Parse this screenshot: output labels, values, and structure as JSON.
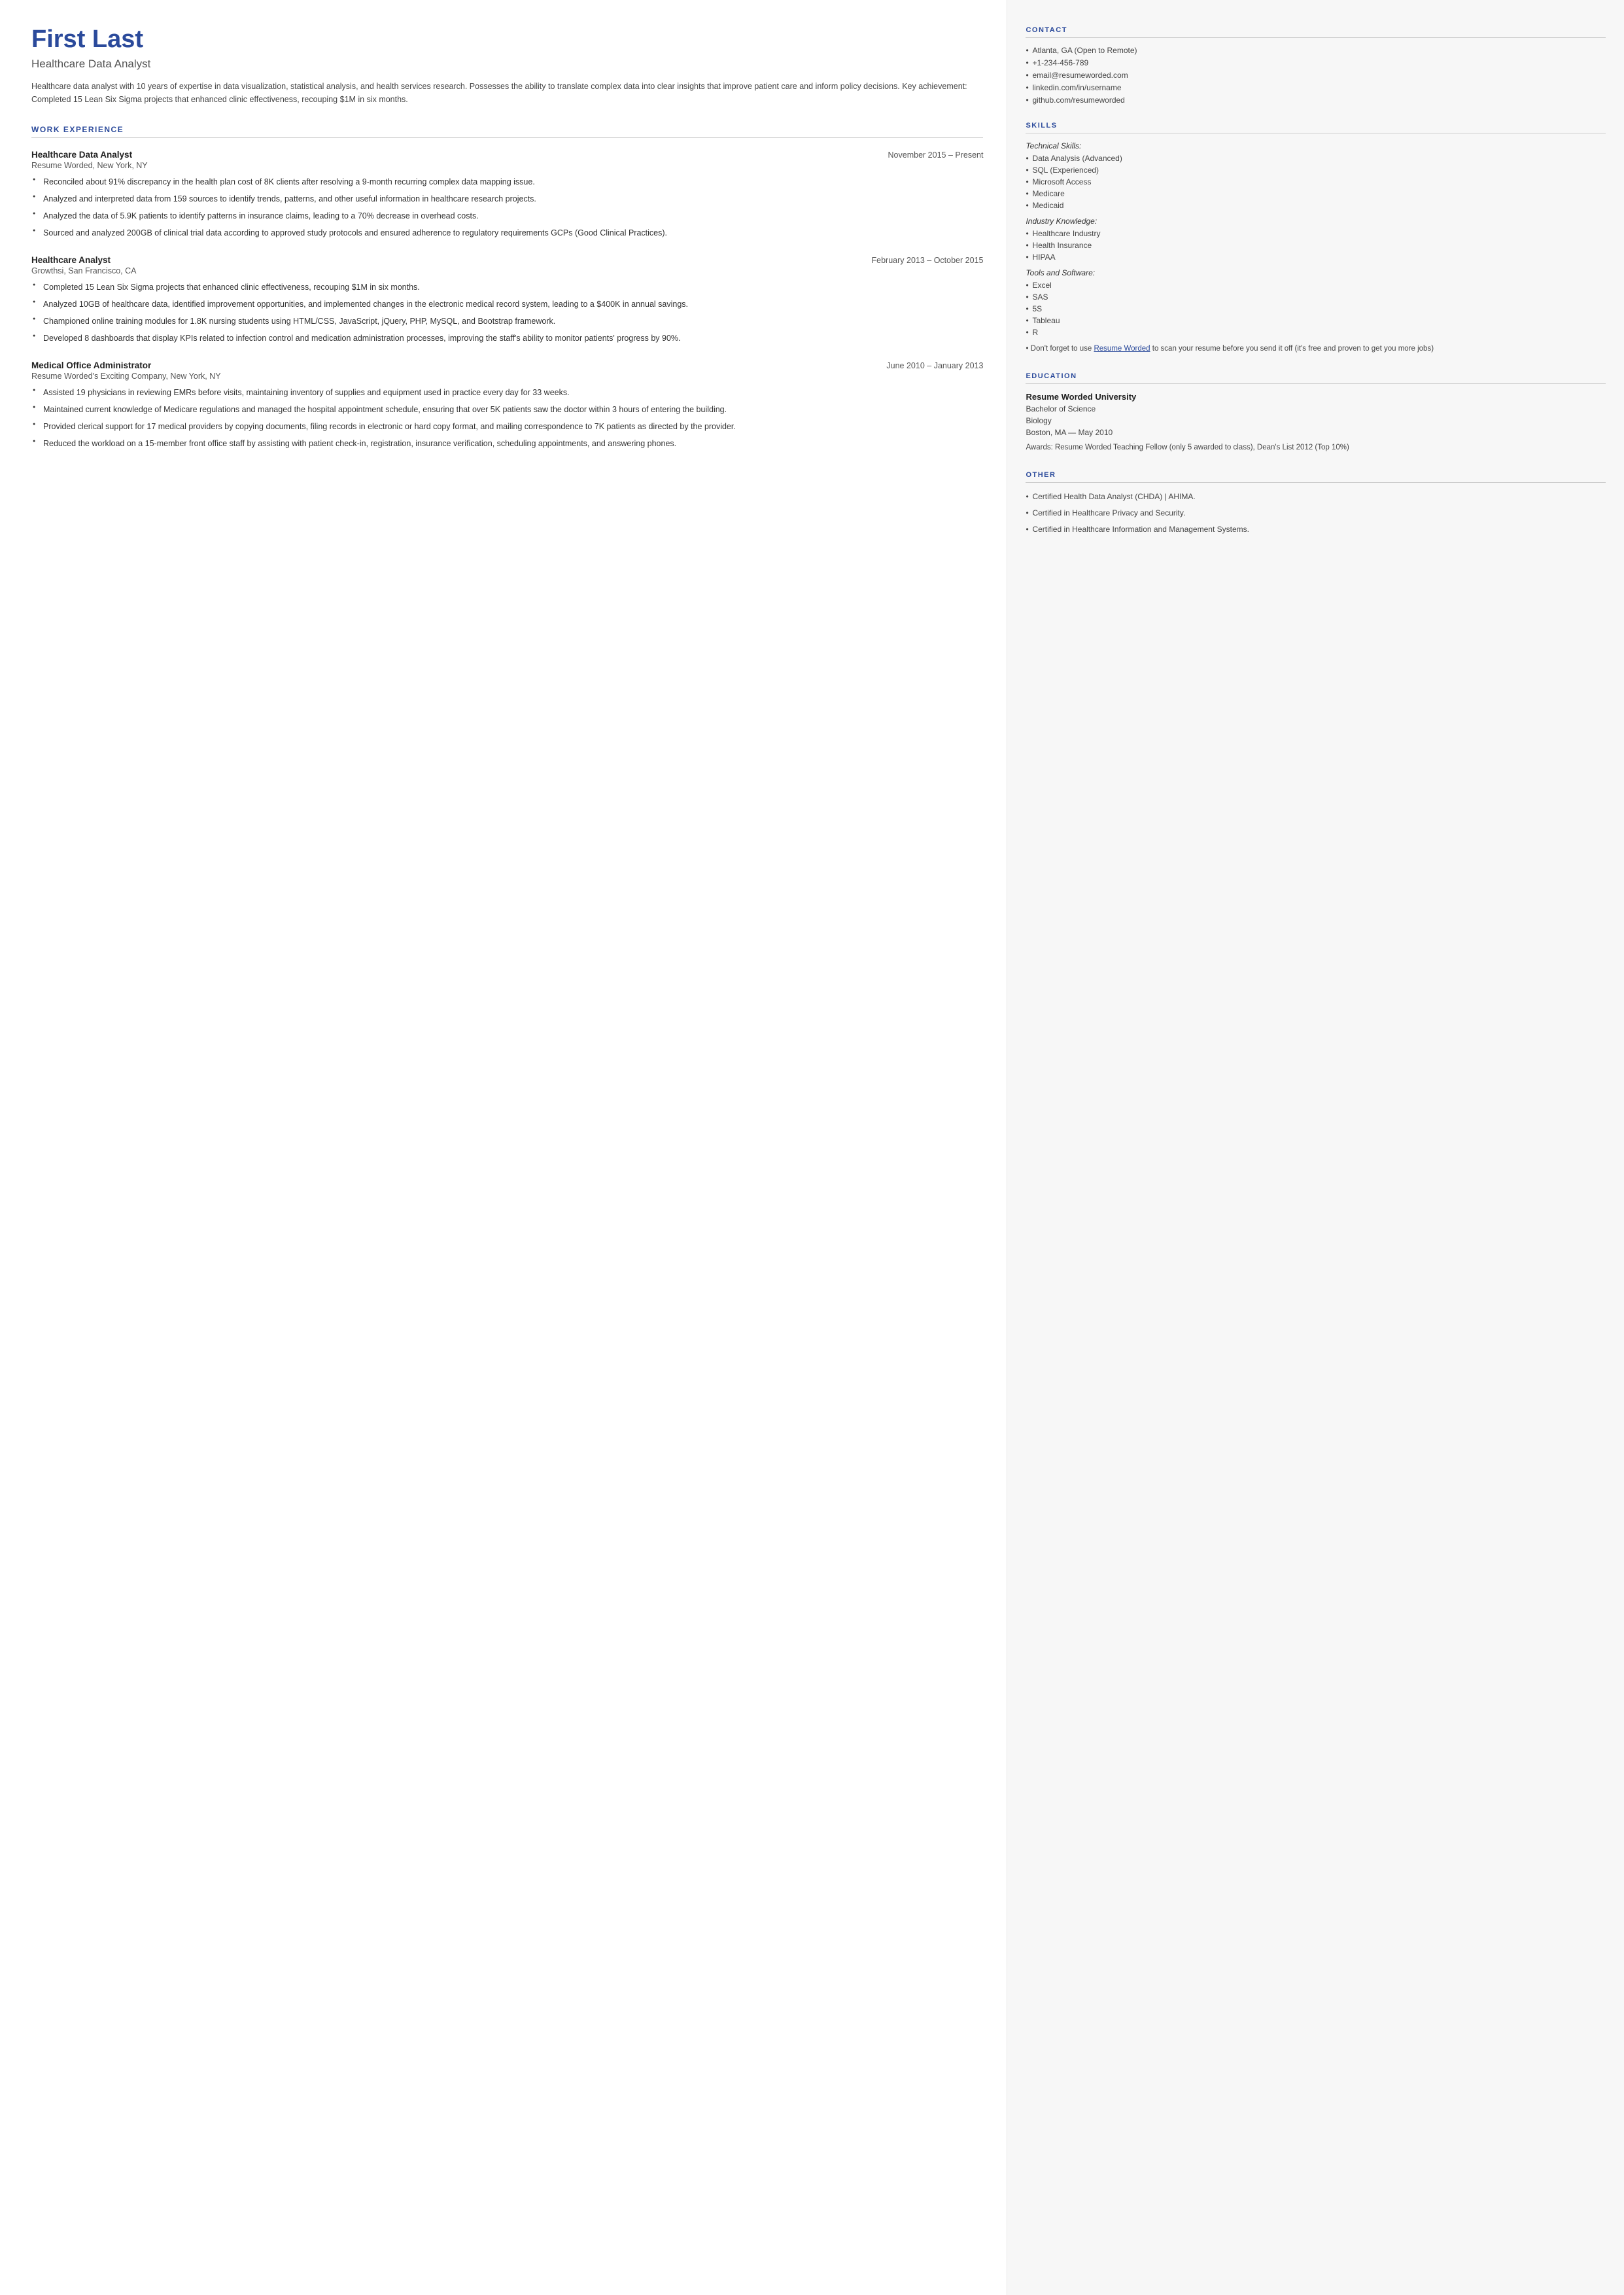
{
  "header": {
    "name": "First Last",
    "title": "Healthcare Data Analyst",
    "summary": "Healthcare data analyst with 10 years of expertise in data visualization, statistical analysis, and health services research. Possesses the ability to translate complex data into clear insights that improve patient care and inform policy decisions. Key achievement: Completed 15 Lean Six Sigma projects that enhanced clinic effectiveness, recouping $1M in six months."
  },
  "sections": {
    "work_experience_label": "WORK EXPERIENCE",
    "skills_label": "SKILLS",
    "contact_label": "CONTACT",
    "education_label": "EDUCATION",
    "other_label": "OTHER"
  },
  "jobs": [
    {
      "title": "Healthcare Data Analyst",
      "dates": "November 2015 – Present",
      "company": "Resume Worded, New York, NY",
      "bullets": [
        "Reconciled about 91% discrepancy in the health plan cost of 8K clients after resolving a 9-month recurring complex data mapping issue.",
        "Analyzed and interpreted data from 159 sources to identify trends, patterns, and other useful information in healthcare research projects.",
        "Analyzed the data of 5.9K patients to identify patterns in insurance claims, leading to a 70% decrease in overhead costs.",
        "Sourced and analyzed 200GB of clinical trial data according to approved study protocols and ensured adherence to regulatory requirements GCPs (Good Clinical Practices)."
      ]
    },
    {
      "title": "Healthcare Analyst",
      "dates": "February 2013 – October 2015",
      "company": "Growthsi, San Francisco, CA",
      "bullets": [
        "Completed 15 Lean Six Sigma projects that enhanced clinic effectiveness, recouping $1M in six months.",
        "Analyzed 10GB of healthcare data, identified improvement opportunities, and implemented changes in the electronic medical record system, leading to a $400K in annual savings.",
        "Championed online training modules for 1.8K nursing students using HTML/CSS, JavaScript, jQuery, PHP, MySQL, and Bootstrap framework.",
        "Developed 8 dashboards that display KPIs related to infection control and medication administration processes, improving the staff's ability to monitor patients' progress by 90%."
      ]
    },
    {
      "title": "Medical Office Administrator",
      "dates": "June 2010 – January 2013",
      "company": "Resume Worded's Exciting Company, New York, NY",
      "bullets": [
        "Assisted 19 physicians in reviewing EMRs before visits, maintaining inventory of supplies and equipment used in practice every day for 33 weeks.",
        "Maintained current knowledge of Medicare regulations and managed the hospital appointment schedule, ensuring that over 5K patients saw the doctor within 3 hours of entering the building.",
        "Provided clerical support for 17 medical providers by copying documents, filing records in electronic or hard copy format, and mailing correspondence to 7K patients as directed by the provider.",
        "Reduced the workload on a 15-member front office staff by assisting with patient check-in, registration, insurance verification, scheduling appointments, and answering phones."
      ]
    }
  ],
  "contact": {
    "items": [
      "Atlanta, GA (Open to Remote)",
      "+1-234-456-789",
      "email@resumeworded.com",
      "linkedin.com/in/username",
      "github.com/resumeworded"
    ]
  },
  "skills": {
    "technical_label": "Technical Skills:",
    "technical_items": [
      "Data Analysis (Advanced)",
      "SQL (Experienced)",
      "Microsoft Access",
      "Medicare",
      "Medicaid"
    ],
    "industry_label": "Industry Knowledge:",
    "industry_items": [
      "Healthcare Industry",
      "Health Insurance",
      "HIPAA"
    ],
    "tools_label": "Tools and Software:",
    "tools_items": [
      "Excel",
      "SAS",
      "5S",
      "Tableau",
      "R"
    ],
    "note_text": "Don't forget to use Resume Worded to scan your resume before you send it off (it's free and proven to get you more jobs)",
    "note_link_text": "Resume Worded"
  },
  "education": {
    "institution": "Resume Worded University",
    "degree": "Bachelor of Science",
    "field": "Biology",
    "location_date": "Boston, MA — May 2010",
    "awards": "Awards: Resume Worded Teaching Fellow (only 5 awarded to class), Dean's List 2012 (Top 10%)"
  },
  "other": {
    "items": [
      "Certified Health Data Analyst (CHDA) | AHIMA.",
      "Certified in Healthcare Privacy and Security.",
      "Certified in Healthcare Information and Management Systems."
    ]
  }
}
